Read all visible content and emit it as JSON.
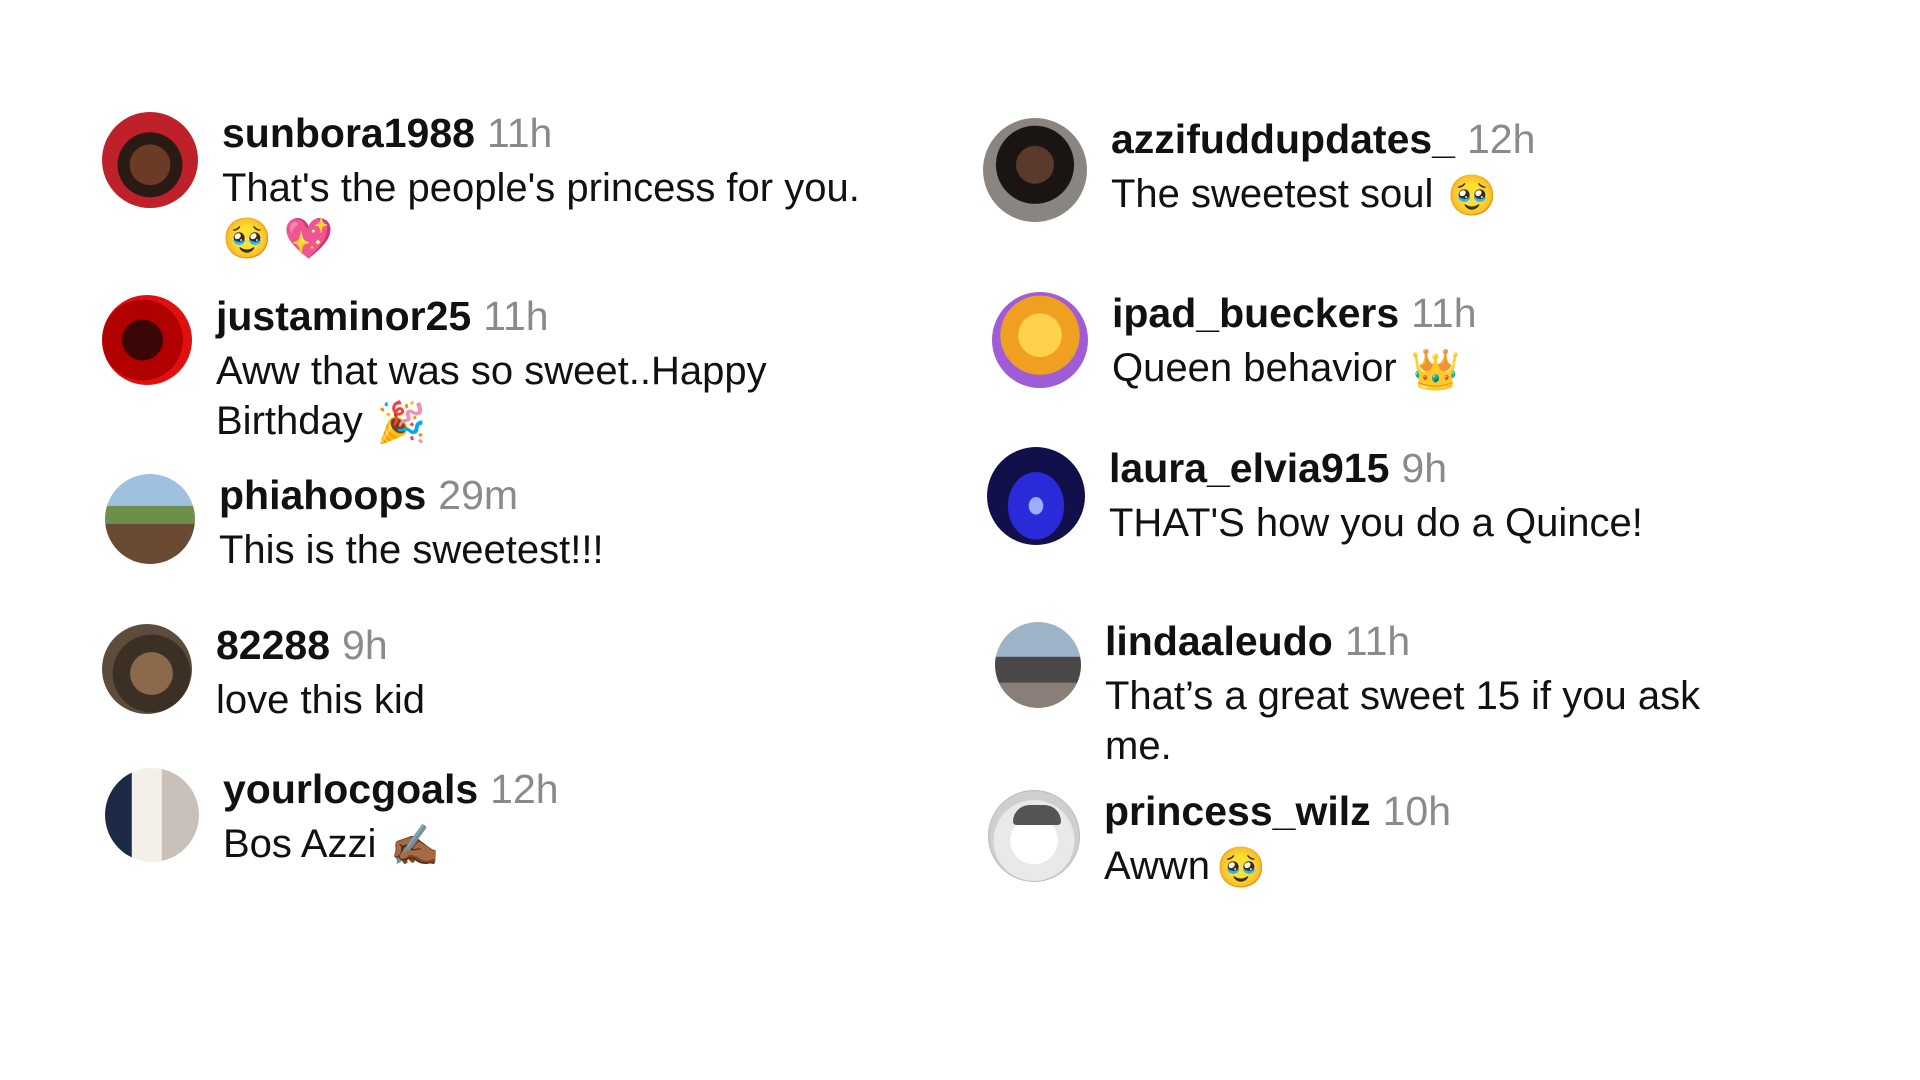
{
  "comments": [
    {
      "username": "sunbora1988",
      "time": "11h",
      "text": "That's the people's princess for you.",
      "emoji": [
        "🥹",
        "💖"
      ]
    },
    {
      "username": "justaminor25",
      "time": "11h",
      "text_line1": "Aww that was so sweet..Happy",
      "text_line2": "Birthday",
      "emoji": "🎉"
    },
    {
      "username": "phiahoops",
      "time": "29m",
      "text": "This is the sweetest!!!"
    },
    {
      "username": "82288",
      "time": "9h",
      "text": "love this kid"
    },
    {
      "username": "yourlocgoals",
      "time": "12h",
      "text": "Bos Azzi",
      "emoji": "✍🏾"
    },
    {
      "username": "azzifuddupdates_",
      "time": "12h",
      "text": "The sweetest soul",
      "emoji": "🥹"
    },
    {
      "username": "ipad_bueckers",
      "time": "11h",
      "text": "Queen behavior",
      "emoji": "👑"
    },
    {
      "username": "laura_elvia915",
      "time": "9h",
      "text": "THAT'S how you do a Quince!"
    },
    {
      "username": "lindaaleudo",
      "time": "11h",
      "text_line1": "That’s a great sweet 15 if you ask",
      "text_line2": "me."
    },
    {
      "username": "princess_wilz",
      "time": "10h",
      "text": "Awwn",
      "emoji": "🥹"
    }
  ]
}
